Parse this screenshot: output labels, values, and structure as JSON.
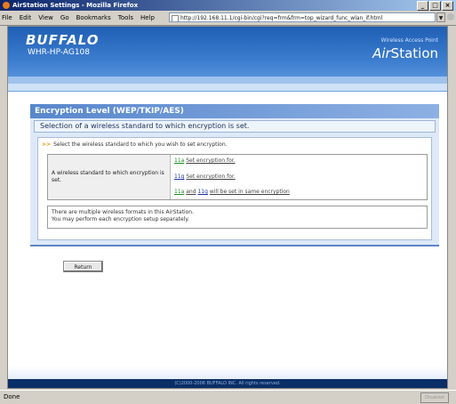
{
  "window": {
    "title": "AirStation Settings - Mozilla Firefox"
  },
  "menu": {
    "items": [
      "File",
      "Edit",
      "View",
      "Go",
      "Bookmarks",
      "Tools",
      "Help"
    ]
  },
  "address": {
    "url": "http://192.168.11.1/cgi-bin/cgi?req=frm&frm=top_wizard_func_wlan_if.html"
  },
  "header": {
    "brand": "BUFFALO",
    "model": "WHR-HP-AG108",
    "tagline": "Wireless Access Point",
    "product_a": "Air",
    "product_b": "Station"
  },
  "section": {
    "title": "Encryption Level (WEP/TKIP/AES)",
    "subtitle": "Selection of a wireless standard to which encryption is set."
  },
  "panel": {
    "hint": "Select the wireless standard to which you wish to set encryption.",
    "row_label": "A wireless standard to which encryption is set.",
    "opt1_band": "11a",
    "opt1_text": "Set encryption for.",
    "opt2_band": "11g",
    "opt2_text": "Set encryption for.",
    "opt3_band_a": "11a",
    "opt3_and": "and",
    "opt3_band_g": "11g",
    "opt3_text": "will be set in same encryption",
    "note_line1": "There are multiple wireless formats in this AirStation.",
    "note_line2": "You may perform each encryption setup separately."
  },
  "buttons": {
    "return": "Return"
  },
  "footer": {
    "copyright": "(C)2000-2006 BUFFALO INC. All rights reserved."
  },
  "status": {
    "text": "Done",
    "right": "Disabled"
  },
  "colors": {
    "band_11a": "#1b8c1b",
    "band_11g": "#1b35a8",
    "header_blue": "#1e5fb4"
  }
}
